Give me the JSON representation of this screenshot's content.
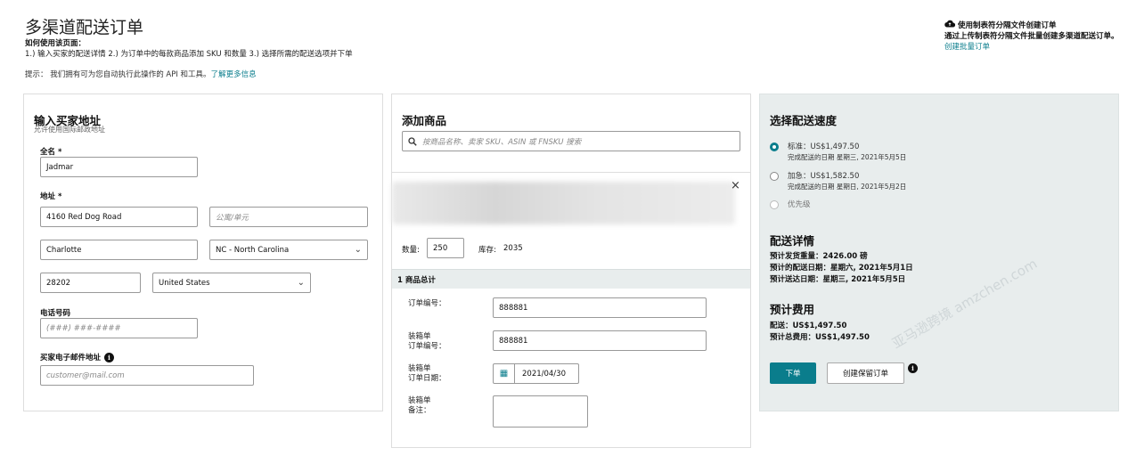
{
  "page": {
    "title": "多渠道配送订单",
    "howto_heading": "如何使用该页面：",
    "howto_text": "1.) 输入买家的配送详情 2.) 为订单中的每款商品添加 SKU 和数量 3.) 选择所需的配送选项并下单",
    "tip_prefix": "提示：  我们拥有可为您自动执行此操作的 API 和工具。",
    "tip_link": "了解更多信息"
  },
  "upload": {
    "icon": "cloud-upload-icon",
    "heading": "使用制表符分隔文件创建订单",
    "desc": "通过上传制表符分隔文件批量创建多渠道配送订单。",
    "link": "创建批量订单"
  },
  "address": {
    "heading": "输入买家地址",
    "subheading": "允许使用国际邮政地址",
    "fullname_label": "全名 *",
    "fullname_value": "Jadmar",
    "address_label": "地址 *",
    "address1_value": "4160  Red Dog Road",
    "address2_placeholder": "公寓/单元",
    "city_value": "Charlotte",
    "state_value": "NC - North Carolina",
    "zip_value": "28202",
    "country_value": "United States",
    "phone_label": "电话号码",
    "phone_placeholder": "(###) ###-####",
    "email_label": "买家电子邮件地址",
    "email_placeholder": "customer@mail.com"
  },
  "products": {
    "heading": "添加商品",
    "search_placeholder": "按商品名称、卖家 SKU、ASIN 或 FNSKU 搜索",
    "quantity_label": "数量:",
    "quantity_value": "250",
    "stock_label": "库存:",
    "stock_value": "2035",
    "total_label": "1 商品总计",
    "order_number_label": "订单编号：",
    "order_number_value": "888881",
    "packing_number_label_1": "装箱单",
    "packing_number_label_2": "订单编号：",
    "packing_number_value": "888881",
    "packing_date_label_1": "装箱单",
    "packing_date_label_2": "订单日期：",
    "packing_date_value": "2021/04/30",
    "packing_note_label_1": "装箱单",
    "packing_note_label_2": "备注："
  },
  "shipping": {
    "heading": "选择配送速度",
    "options": [
      {
        "label": "标准：US$1,497.50",
        "sub": "完成配送的日期 星期三, 2021年5月5日",
        "selected": true
      },
      {
        "label": "加急：US$1,582.50",
        "sub": "完成配送的日期 星期日, 2021年5月2日",
        "selected": false
      },
      {
        "label": "优先级",
        "sub": "",
        "selected": false
      }
    ],
    "details_heading": "配送详情",
    "weight": "预计发货重量：2426.00 磅",
    "ship_date": "预计的配送日期：星期六, 2021年5月1日",
    "arrive_date": "预计送达日期：星期三, 2021年5月5日",
    "fees_heading": "预计费用",
    "ship_fee": "配送：US$1,497.50",
    "total_fee": "预计总费用：US$1,497.50",
    "place_order": "下单",
    "hold_order": "创建保留订单"
  },
  "watermark": "亚马逊跨境 amzchen.com",
  "colors": {
    "accent": "#0a7d8c",
    "panel_gray": "#e8eded"
  }
}
